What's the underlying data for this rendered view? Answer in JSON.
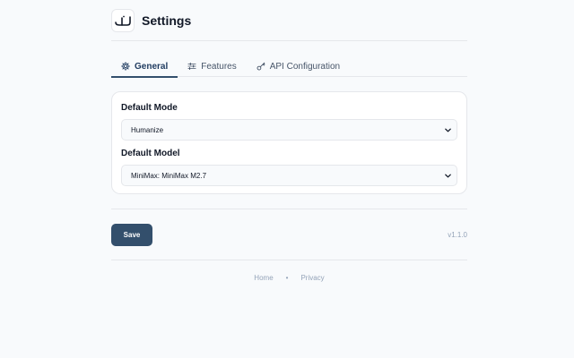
{
  "header": {
    "logo_text": "لب",
    "title": "Settings"
  },
  "tabs": [
    {
      "label": "General",
      "icon": "gear-icon",
      "active": true
    },
    {
      "label": "Features",
      "icon": "sliders-icon",
      "active": false
    },
    {
      "label": "API Configuration",
      "icon": "key-icon",
      "active": false
    }
  ],
  "general": {
    "default_mode": {
      "label": "Default Mode",
      "value": "Humanize"
    },
    "default_model": {
      "label": "Default Model",
      "value": "MiniMax: MiniMax M2.7"
    }
  },
  "actions": {
    "save_label": "Save",
    "version": "v1.1.0"
  },
  "footer": {
    "home": "Home",
    "separator": "•",
    "privacy": "Privacy"
  },
  "colors": {
    "accent": "#334f6c",
    "background": "#f8fafc",
    "card": "#ffffff",
    "border": "#e5e7eb",
    "muted_text": "#94a3b8"
  }
}
